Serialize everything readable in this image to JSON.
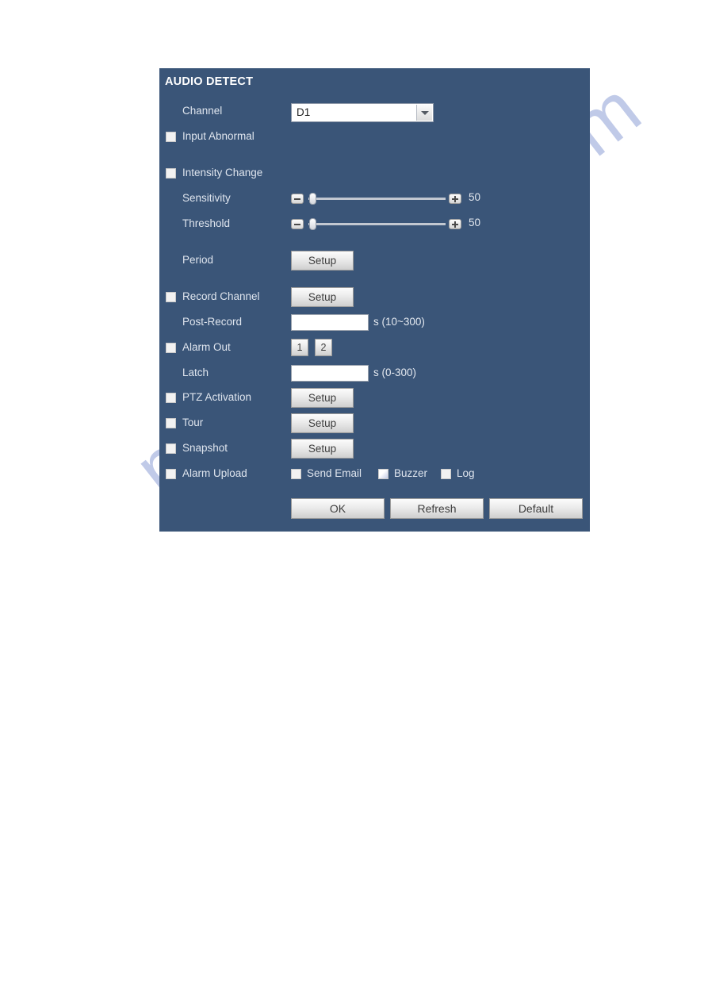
{
  "watermark": {
    "text": "manualshive.com"
  },
  "panel": {
    "title": "AUDIO DETECT",
    "bg_color": "#3a5578",
    "label_color": "#dfe5ee"
  },
  "fields": {
    "channel": {
      "label": "Channel",
      "value": "D1",
      "options": [
        "D1"
      ],
      "dropdown_icon": "chevron-down-icon"
    },
    "input_abnormal": {
      "label": "Input Abnormal",
      "checked": false
    },
    "intensity_change": {
      "label": "Intensity Change",
      "checked": false
    },
    "sensitivity": {
      "label": "Sensitivity",
      "value": "50",
      "min": 0,
      "max": 100,
      "decrement_icon": "minus-icon",
      "increment_icon": "plus-icon"
    },
    "threshold": {
      "label": "Threshold",
      "value": "50",
      "min": 0,
      "max": 100,
      "decrement_icon": "minus-icon",
      "increment_icon": "plus-icon"
    },
    "period": {
      "label": "Period",
      "button": "Setup"
    },
    "record_channel": {
      "label": "Record Channel",
      "checked": false,
      "button": "Setup"
    },
    "post_record": {
      "label": "Post-Record",
      "value": "",
      "unit": "s (10~300)"
    },
    "alarm_out": {
      "label": "Alarm Out",
      "checked": false,
      "ports": [
        "1",
        "2"
      ]
    },
    "latch": {
      "label": "Latch",
      "value": "",
      "unit": "s (0-300)"
    },
    "ptz_activation": {
      "label": "PTZ Activation",
      "checked": false,
      "button": "Setup"
    },
    "tour": {
      "label": "Tour",
      "checked": false,
      "button": "Setup"
    },
    "snapshot": {
      "label": "Snapshot",
      "checked": false,
      "button": "Setup"
    },
    "alarm_upload": {
      "label": "Alarm Upload",
      "checked": false,
      "options": [
        {
          "label": "Send Email",
          "checked": false
        },
        {
          "label": "Buzzer",
          "checked": false
        },
        {
          "label": "Log",
          "checked": false
        }
      ]
    }
  },
  "actions": {
    "ok": "OK",
    "refresh": "Refresh",
    "default": "Default"
  }
}
